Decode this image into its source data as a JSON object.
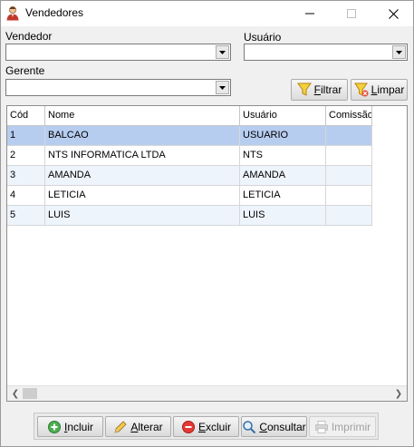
{
  "window": {
    "title": "Vendedores",
    "icon": "salesperson-icon"
  },
  "filters": {
    "vendedor_label": "Vendedor",
    "usuario_label": "Usuário",
    "gerente_label": "Gerente",
    "vendedor_value": "",
    "usuario_value": "",
    "gerente_value": "",
    "filtrar_first": "F",
    "filtrar_rest": "iltrar",
    "limpar_first": "L",
    "limpar_rest": "impar"
  },
  "grid": {
    "columns": [
      "Cód",
      "Nome",
      "Usuário",
      "Comissão"
    ],
    "rows": [
      {
        "cod": "1",
        "nome": "BALCAO",
        "usuario": "USUARIO",
        "comissao": "",
        "selected": true
      },
      {
        "cod": "2",
        "nome": "NTS INFORMATICA LTDA",
        "usuario": "NTS",
        "comissao": ""
      },
      {
        "cod": "3",
        "nome": "AMANDA",
        "usuario": "AMANDA",
        "comissao": ""
      },
      {
        "cod": "4",
        "nome": "LETICIA",
        "usuario": "LETICIA",
        "comissao": ""
      },
      {
        "cod": "5",
        "nome": "LUIS",
        "usuario": "LUIS",
        "comissao": ""
      }
    ]
  },
  "actions": {
    "incluir_first": "I",
    "incluir_rest": "ncluir",
    "alterar_first": "A",
    "alterar_rest": "lterar",
    "excluir_first": "E",
    "excluir_rest": "xcluir",
    "consultar_first": "C",
    "consultar_rest": "onsultar",
    "imprimir_label": "Imprimir"
  },
  "colors": {
    "selected_row": "#b7cdf0",
    "alt_row": "#eef4fc",
    "title_bg": "#ffffff"
  }
}
